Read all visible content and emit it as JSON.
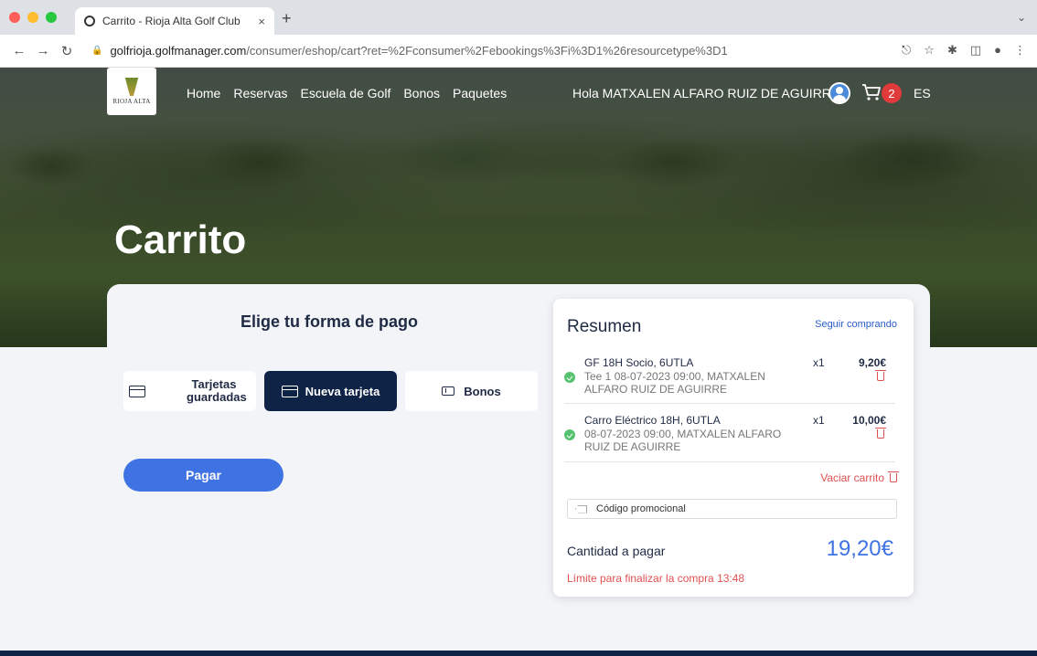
{
  "browser": {
    "tab_title": "Carrito - Rioja Alta Golf Club",
    "new_tab": "+",
    "close_tab": "×",
    "url_host": "golfrioja.golfmanager.com",
    "url_path": "/consumer/eshop/cart?ret=%2Fconsumer%2Febookings%3Fi%3D1%26resourcetype%3D1"
  },
  "site": {
    "logo_text": "RIOJA ALTA",
    "nav": [
      "Home",
      "Reservas",
      "Escuela de Golf",
      "Bonos",
      "Paquetes"
    ],
    "greeting": "Hola MATXALEN ALFARO RUIZ DE AGUIRRE",
    "cart_count": "2",
    "language": "ES"
  },
  "hero": {
    "title": "Carrito"
  },
  "payment": {
    "title": "Elige tu forma de pago",
    "methods": {
      "saved": "Tarjetas guardadas",
      "new_card": "Nueva tarjeta",
      "bonos": "Bonos"
    },
    "pay_button": "Pagar"
  },
  "summary": {
    "title": "Resumen",
    "continue_shopping": "Seguir comprando",
    "items": [
      {
        "name": "GF 18H Socio, 6UTLA",
        "desc": "Tee 1 08-07-2023 09:00, MATXALEN ALFARO RUIZ DE AGUIRRE",
        "qty": "x1",
        "price": "9,20€"
      },
      {
        "name": "Carro Eléctrico 18H, 6UTLA",
        "desc": "08-07-2023 09:00, MATXALEN ALFARO RUIZ DE AGUIRRE",
        "qty": "x1",
        "price": "10,00€"
      }
    ],
    "empty_cart": "Vaciar carrito",
    "promo_placeholder": "Código promocional",
    "amount_label": "Cantidad a pagar",
    "amount": "19,20€",
    "time_limit": "Límite para finalizar la compra 13:48"
  },
  "colors": {
    "primary": "#3f73e4",
    "navy": "#0f2347",
    "danger": "#e05050",
    "success": "#56c26f"
  }
}
